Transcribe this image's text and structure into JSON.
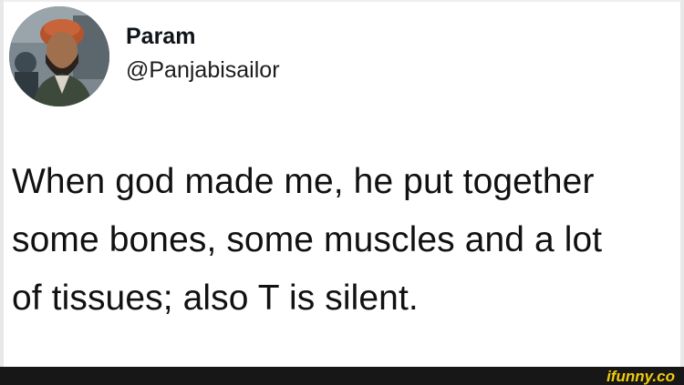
{
  "tweet": {
    "author": {
      "display_name": "Param",
      "handle": "@Panjabisailor"
    },
    "text_lines": [
      "When god made me, he put together",
      "some bones, some muscles and a lot",
      "of tissues; also T is silent."
    ]
  },
  "watermark": {
    "text": "ifunny.co",
    "color": "#f2cc0c"
  },
  "colors": {
    "background": "#ffffff",
    "text": "#111111",
    "footer_bar": "#171717"
  }
}
